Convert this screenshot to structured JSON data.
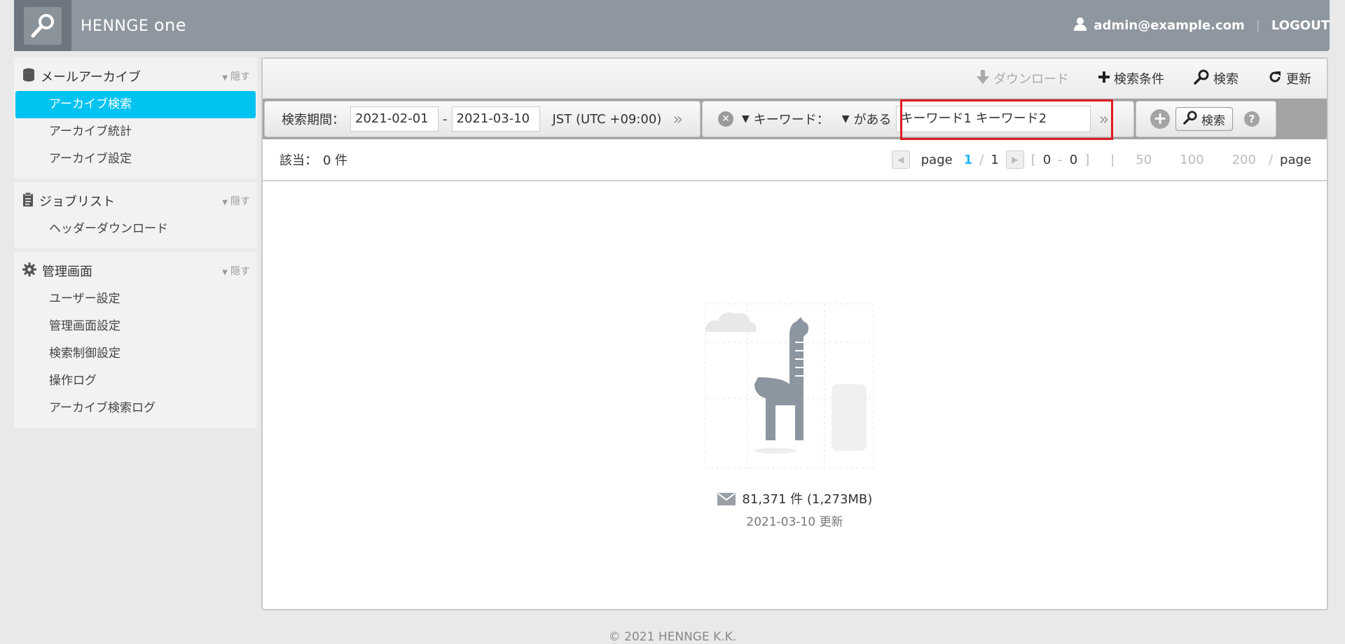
{
  "header": {
    "brand": "HENNGE",
    "brand_suffix": "one",
    "user": "admin@example.com",
    "logout": "LOGOUT"
  },
  "sidebar": {
    "sections": [
      {
        "title": "メールアーカイブ",
        "hide": "隠す",
        "items": [
          "アーカイブ検索",
          "アーカイブ統計",
          "アーカイブ設定"
        ]
      },
      {
        "title": "ジョブリスト",
        "hide": "隠す",
        "items": [
          "ヘッダーダウンロード"
        ]
      },
      {
        "title": "管理画面",
        "hide": "隠す",
        "items": [
          "ユーザー設定",
          "管理画面設定",
          "検索制御設定",
          "操作ログ",
          "アーカイブ検索ログ"
        ]
      }
    ],
    "active_item": "アーカイブ検索"
  },
  "toolbar": {
    "download": "ダウンロード",
    "conditions": "検索条件",
    "search": "検索",
    "refresh": "更新"
  },
  "filter": {
    "period_label": "検索期間：",
    "date_from": "2021-02-01",
    "date_sep": "-",
    "date_to": "2021-03-10",
    "timezone": "JST (UTC +09:00)",
    "keyword_label": "キーワード：",
    "keyword_mode": "がある",
    "keyword_value": "キーワード1 キーワード2",
    "search_button": "検索"
  },
  "results": {
    "label": "該当：",
    "count": "0 件",
    "page_word": "page",
    "current_page": "1",
    "slash": "/",
    "total_pages": "1",
    "range_open": "[",
    "range_from": "0",
    "range_sep": "-",
    "range_to": "0",
    "range_close": "]",
    "divider": "|",
    "sizes": [
      "50",
      "100",
      "200"
    ],
    "per_page": "page"
  },
  "stats": {
    "summary": "81,371 件 (1,273MB)",
    "updated": "2021-03-10 更新"
  },
  "footer": {
    "copyright": "© 2021 HENNGE K.K."
  }
}
